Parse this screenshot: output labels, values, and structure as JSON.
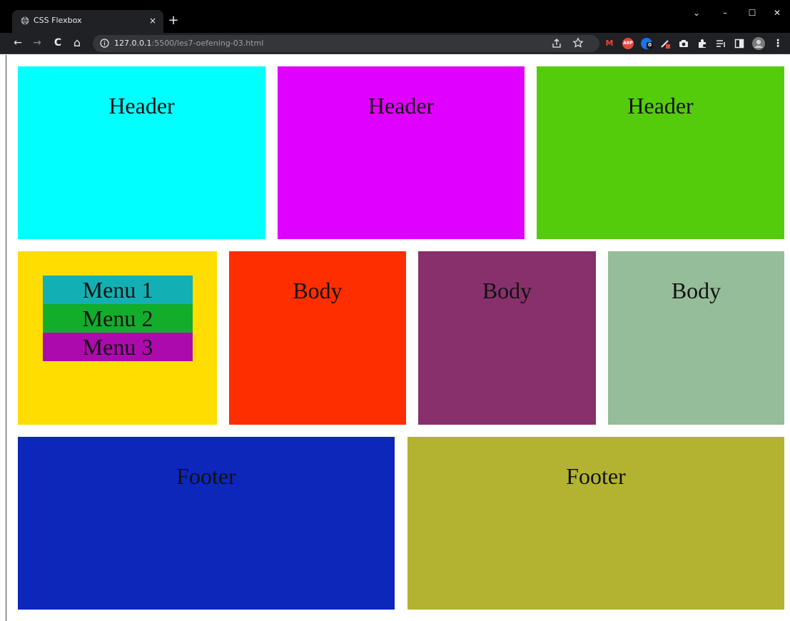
{
  "browser": {
    "tab_title": "CSS Flexbox",
    "tab_close": "×",
    "new_tab": "+",
    "url_host": "127.0.0.1",
    "url_rest": ":5500/les7-oefening-03.html",
    "window_controls": {
      "chevron": "⌄",
      "minimize": "–",
      "maximize": "☐",
      "close": "✕"
    },
    "nav": {
      "back": "←",
      "forward": "→",
      "reload": "C",
      "home": "⌂"
    },
    "extensions": [
      "gmail-icon",
      "adblock-icon",
      "extension-badge-icon",
      "color-picker-icon",
      "camera-icon",
      "puzzle-icon",
      "reading-list-icon",
      "side-panel-icon",
      "profile-avatar-icon",
      "kebab-menu-icon"
    ],
    "ext_labels": {
      "gmail": "M",
      "adblock": "ABP",
      "badge": "0",
      "menu": "⋮"
    }
  },
  "layout": {
    "headers": [
      {
        "label": "Header",
        "color": "#00ffff"
      },
      {
        "label": "Header",
        "color": "#e000ff"
      },
      {
        "label": "Header",
        "color": "#55cc0b"
      }
    ],
    "sidebar": {
      "color": "#ffdd00",
      "menu": [
        {
          "label": "Menu 1",
          "color": "#12b0b4"
        },
        {
          "label": "Menu 2",
          "color": "#12ad2a"
        },
        {
          "label": "Menu 3",
          "color": "#ad0aad"
        }
      ]
    },
    "bodies": [
      {
        "label": "Body",
        "color": "#ff2e00"
      },
      {
        "label": "Body",
        "color": "#88306c"
      },
      {
        "label": "Body",
        "color": "#96bd99"
      }
    ],
    "footers": [
      {
        "label": "Footer",
        "color": "#0d27bb"
      },
      {
        "label": "Footer",
        "color": "#b3b331"
      }
    ]
  }
}
